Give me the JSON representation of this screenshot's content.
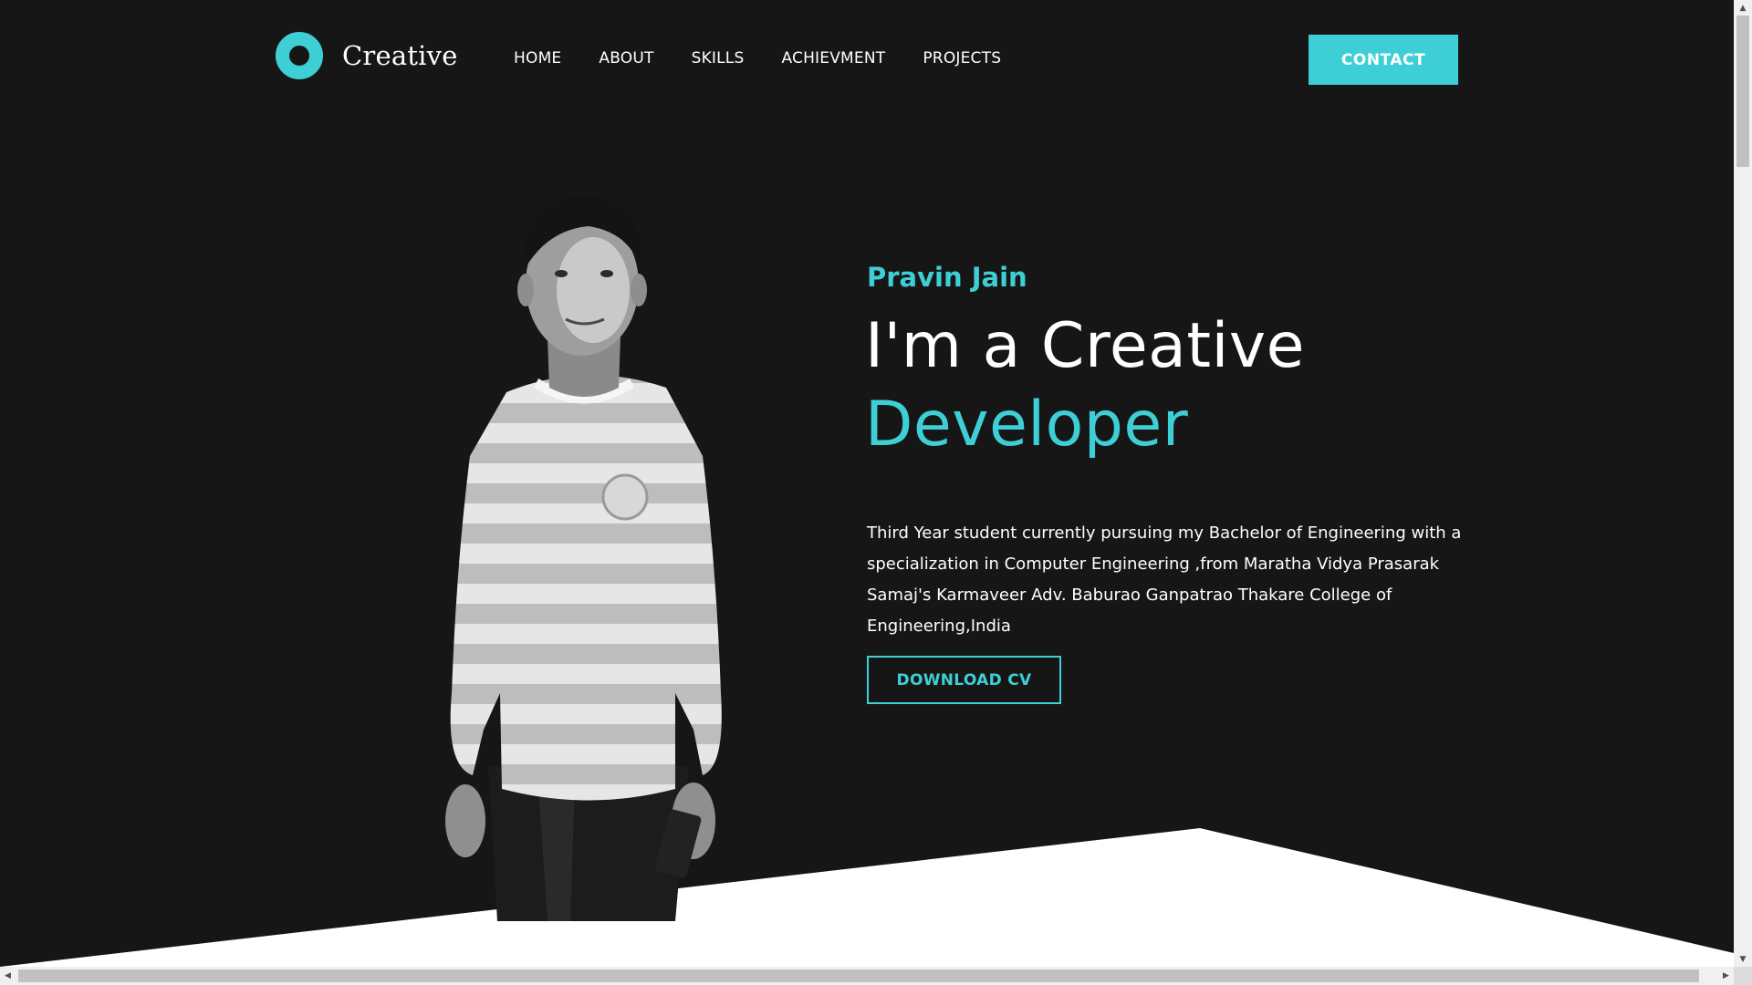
{
  "brand": {
    "logo_text": "Creative",
    "accent_color": "#3ecfd6",
    "background_color": "#161616"
  },
  "nav": {
    "items": [
      "HOME",
      "ABOUT",
      "SKILLS",
      "ACHIEVMENT",
      "PROJECTS"
    ]
  },
  "header": {
    "contact_label": "CONTACT"
  },
  "hero": {
    "name": "Pravin Jain",
    "headline_line1": "I'm a Creative",
    "headline_line2": "Developer",
    "description": "Third Year student currently pursuing my Bachelor of Engineering with a specialization in Computer Engineering ,from Maratha Vidya Prasarak Samaj's Karmaveer Adv. Baburao Ganpatrao Thakare College of Engineering,India",
    "download_label": "DOWNLOAD CV",
    "photo_icon": "portrait-photo"
  },
  "scrollbars": {
    "up_icon": "▲",
    "down_icon": "▼",
    "left_icon": "◀",
    "right_icon": "▶"
  }
}
